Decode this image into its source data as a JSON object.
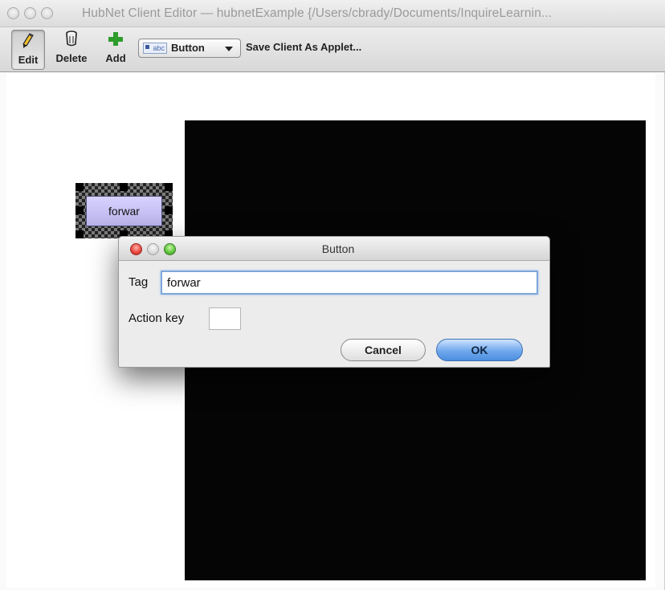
{
  "window": {
    "title": "HubNet Client Editor — hubnetExample {/Users/cbrady/Documents/InquireLearnin..."
  },
  "toolbar": {
    "edit_label": "Edit",
    "delete_label": "Delete",
    "add_label": "Add",
    "widget_type": "Button",
    "widget_type_icon_text": "abc",
    "save_applet_label": "Save Client As Applet..."
  },
  "canvas": {
    "selected_widget_label": "forwar"
  },
  "dialog": {
    "title": "Button",
    "tag_label": "Tag",
    "tag_value": "forwar",
    "action_key_label": "Action key",
    "action_key_value": "",
    "cancel_label": "Cancel",
    "ok_label": "OK"
  },
  "colors": {
    "view_background": "#050505",
    "widget_fill": "#c7c0f5",
    "ok_button": "#6fa8ec"
  },
  "icons": {
    "edit": "pencil-icon",
    "delete": "trash-can-icon",
    "add": "green-plus-icon",
    "widget_type": "abc-widget-icon"
  }
}
